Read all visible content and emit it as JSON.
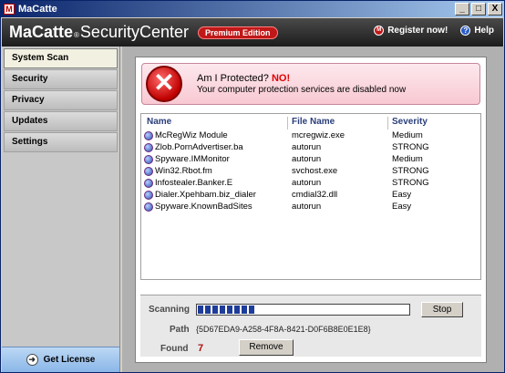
{
  "window": {
    "title": "MaCatte",
    "icon_letter": "M",
    "min": "_",
    "max": "□",
    "close": "X"
  },
  "header": {
    "brand_main": "MaCatte",
    "brand_reg": "®",
    "brand_rest": "SecurityCenter",
    "edition": "Premium Edition",
    "register": "Register now!",
    "help": "Help"
  },
  "sidebar": {
    "items": [
      {
        "label": "System Scan",
        "active": true
      },
      {
        "label": "Security"
      },
      {
        "label": "Privacy"
      },
      {
        "label": "Updates"
      },
      {
        "label": "Settings"
      }
    ],
    "get_license": "Get License"
  },
  "alert": {
    "question": "Am I Protected?",
    "answer": "NO!",
    "message": "Your computer protection services are disabled now"
  },
  "table": {
    "columns": [
      "Name",
      "File Name",
      "Severity"
    ],
    "rows": [
      {
        "name": "McRegWiz Module",
        "file": "mcregwiz.exe",
        "severity": "Medium"
      },
      {
        "name": "Zlob.PornAdvertiser.ba",
        "file": "autorun",
        "severity": "STRONG"
      },
      {
        "name": "Spyware.IMMonitor",
        "file": "autorun",
        "severity": "Medium"
      },
      {
        "name": "Win32.Rbot.fm",
        "file": "svchost.exe",
        "severity": "STRONG"
      },
      {
        "name": "Infostealer.Banker.E",
        "file": "autorun",
        "severity": "STRONG"
      },
      {
        "name": "Dialer.Xpehbam.biz_dialer",
        "file": "cmdial32.dll",
        "severity": "Easy"
      },
      {
        "name": "Spyware.KnownBadSites",
        "file": "autorun",
        "severity": "Easy"
      }
    ]
  },
  "scan": {
    "scanning_label": "Scanning",
    "progress_fraction": 0.27,
    "stop": "Stop",
    "path_label": "Path",
    "path_value": "{5D67EDA9-A258-4F8A-8421-D0F6B8E0E1E8}",
    "found_label": "Found",
    "found_value": "7",
    "remove": "Remove"
  }
}
